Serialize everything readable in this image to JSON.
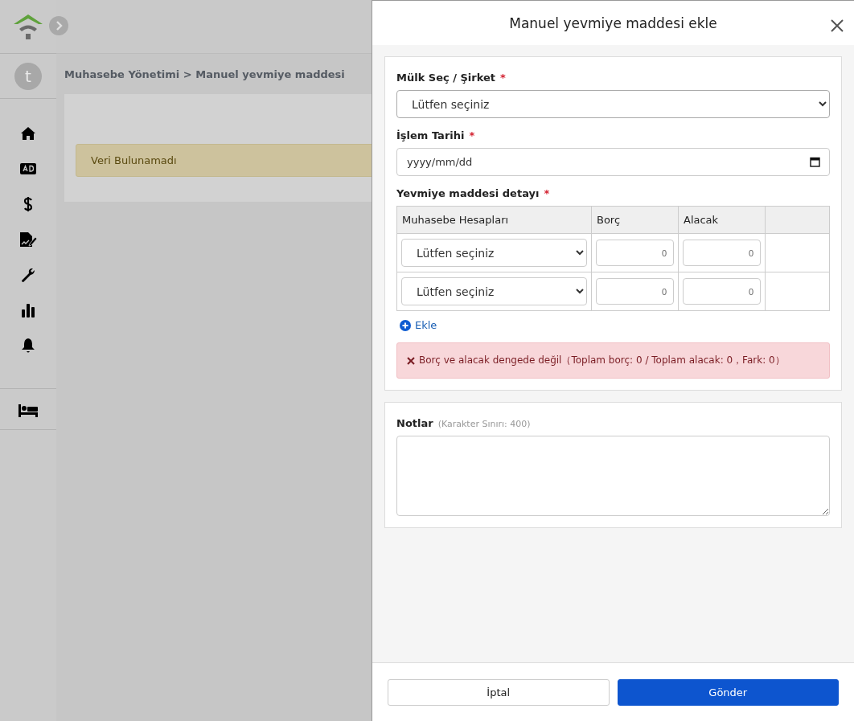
{
  "sidebar": {
    "avatar_letter": "t",
    "items": [
      {
        "kind": "home"
      },
      {
        "kind": "ad"
      },
      {
        "kind": "dollar"
      },
      {
        "kind": "report"
      },
      {
        "kind": "wrench"
      },
      {
        "kind": "chart"
      },
      {
        "kind": "bell"
      }
    ],
    "bottom_items": [
      {
        "kind": "bed"
      }
    ]
  },
  "breadcrumb": "Muhasebe Yönetimi > Manuel yevmiye maddesi",
  "empty_alert": "Veri Bulunamadı",
  "modal": {
    "title": "Manuel yevmiye maddesi ekle",
    "property_label": "Mülk Seç / Şirket",
    "property_value": "Lütfen seçiniz",
    "date_label": "İşlem Tarihi",
    "date_placeholder": "yyyy/mm/dd",
    "detail_label": "Yevmiye maddesi detayı",
    "required_mark": "*",
    "columns": [
      "Muhasebe Hesapları",
      "Borç",
      "Alacak"
    ],
    "rows": [
      {
        "account": "Lütfen seçiniz",
        "debit_placeholder": "0",
        "credit_placeholder": "0"
      },
      {
        "account": "Lütfen seçiniz",
        "debit_placeholder": "0",
        "credit_placeholder": "0"
      }
    ],
    "add_link": "Ekle",
    "error": "Borç ve alacak dengede değil（Toplam borç: 0 / Toplam alacak: 0，Fark: 0）",
    "notes_label": "Notlar",
    "notes_hint": "(Karakter Sınırı: 400)",
    "buttons": [
      {
        "label": "İptal",
        "kind": "secondary"
      },
      {
        "label": "Gönder",
        "kind": "primary"
      }
    ]
  }
}
